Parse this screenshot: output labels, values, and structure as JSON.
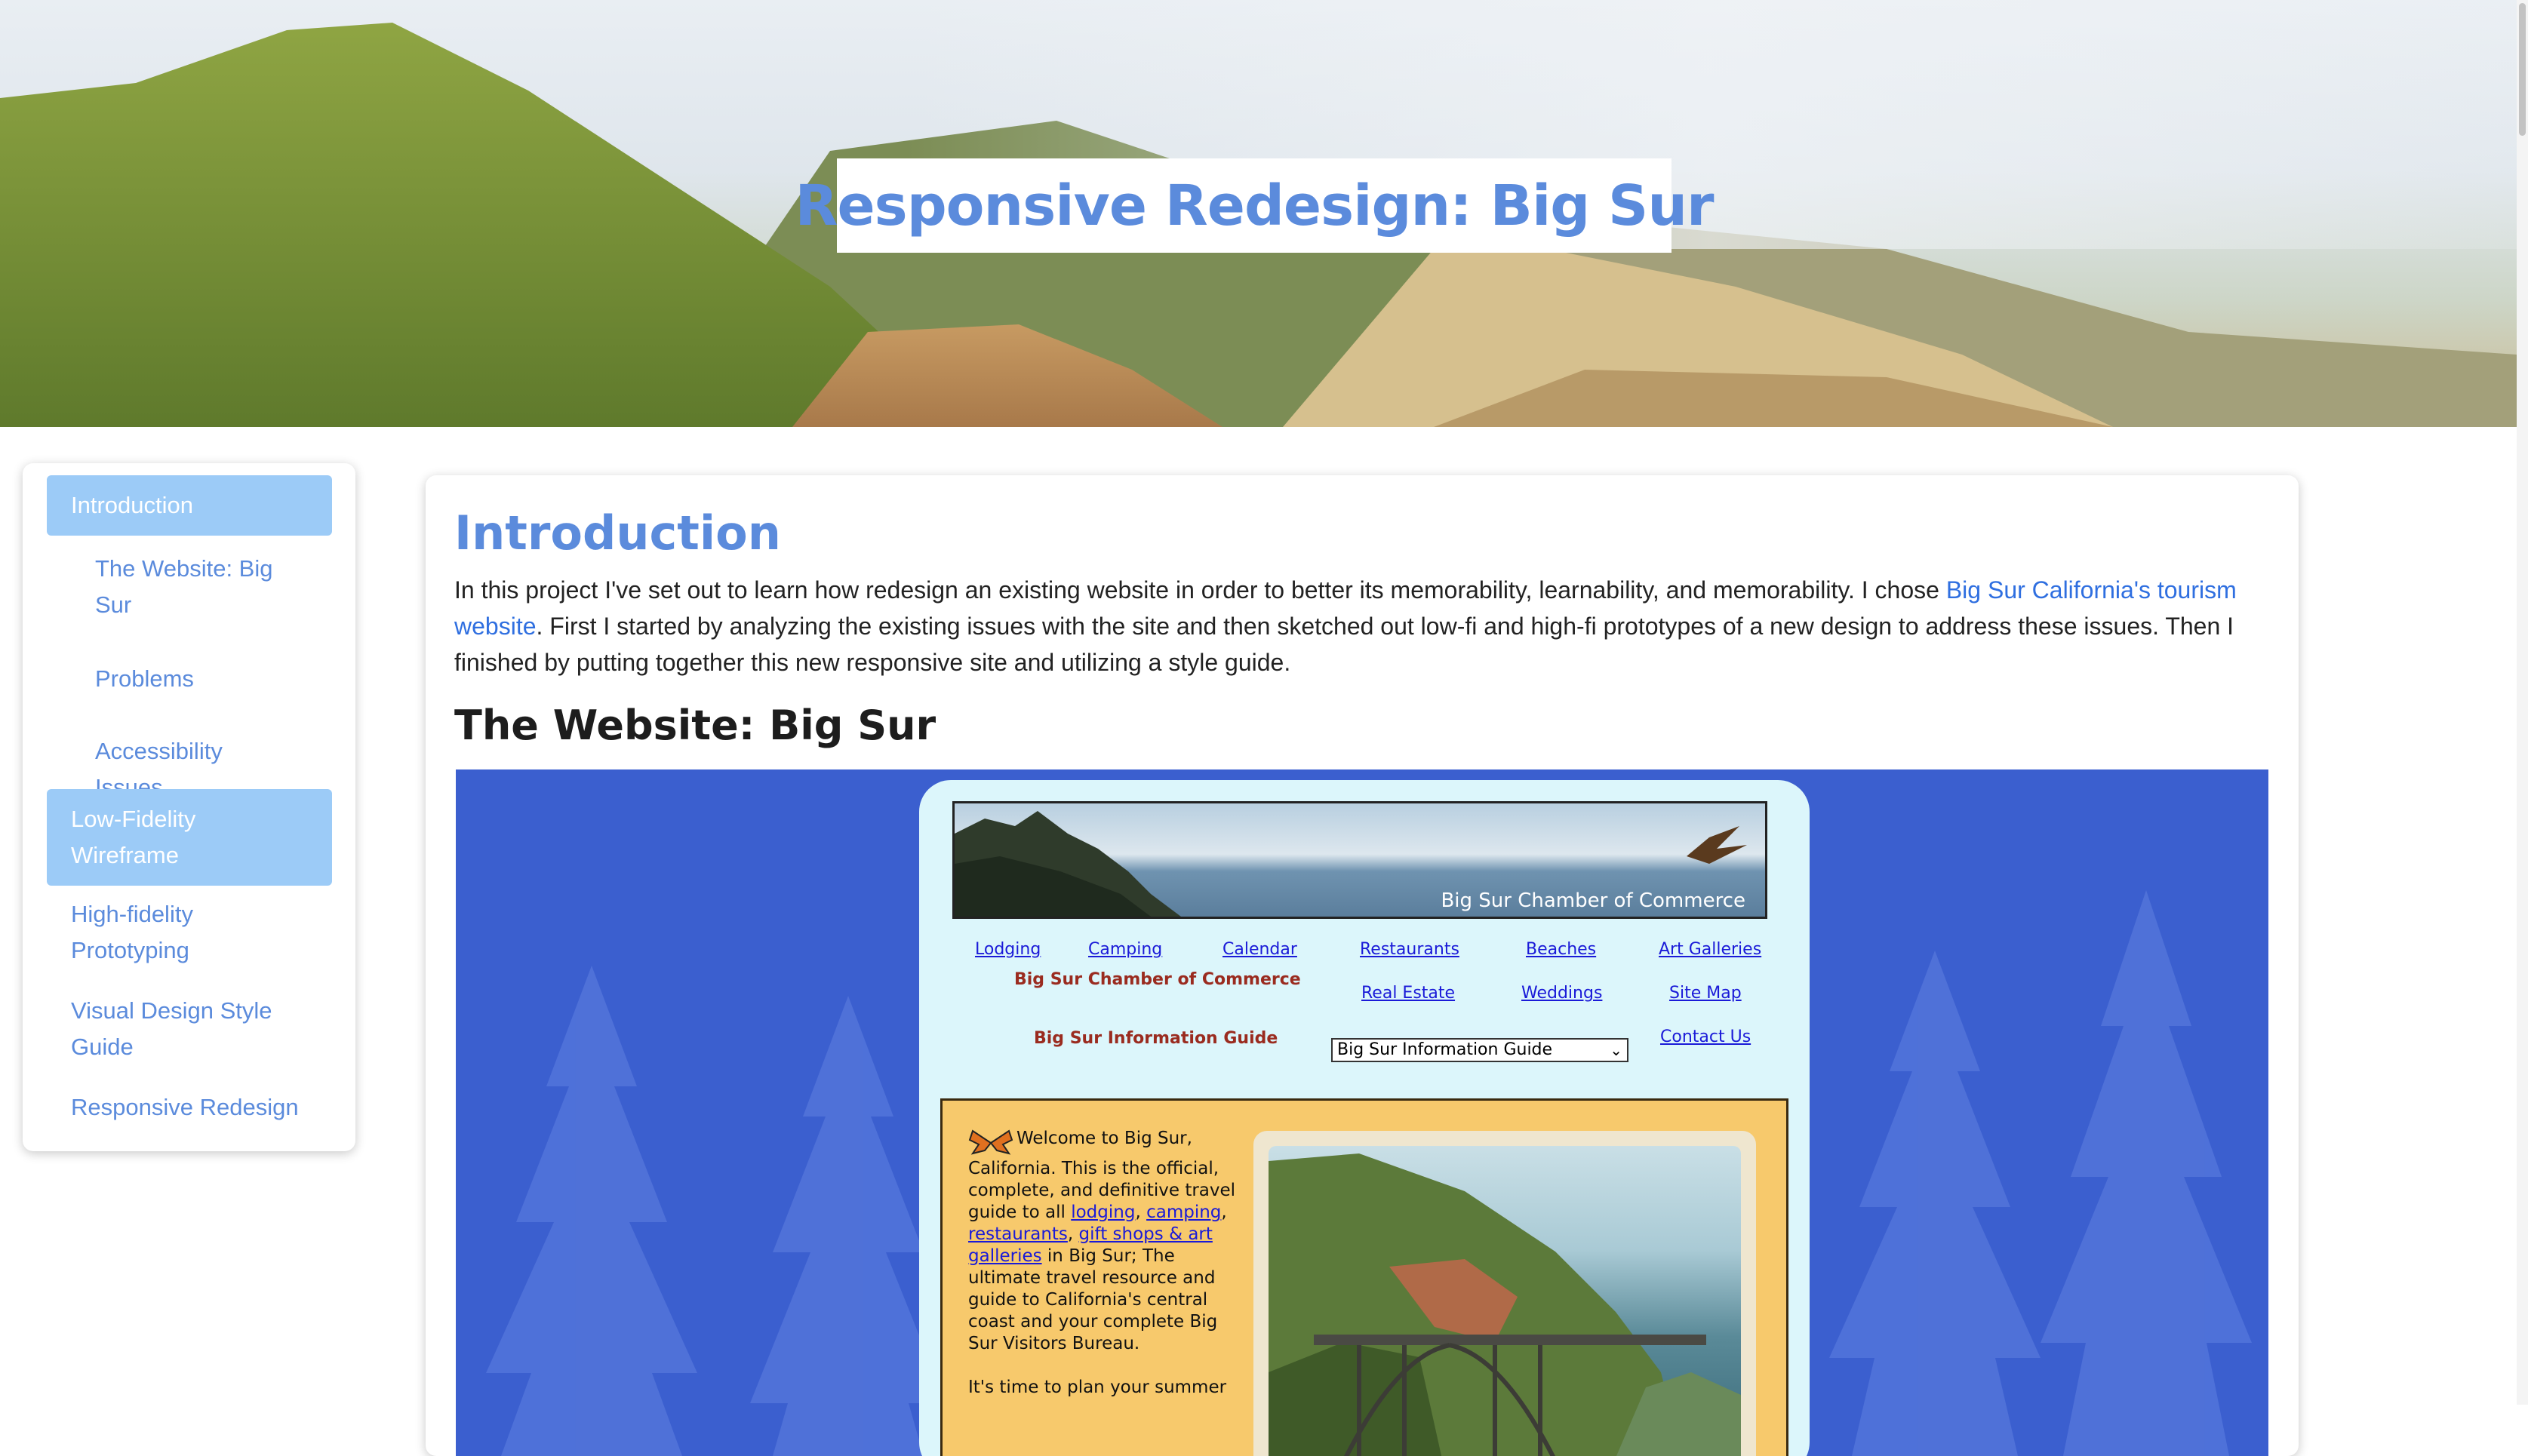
{
  "hero": {
    "title": "Responsive Redesign: Big Sur"
  },
  "sidebar": {
    "items": [
      {
        "label": "Introduction"
      },
      {
        "label": "The Website: Big Sur"
      },
      {
        "label": "Problems"
      },
      {
        "label": "Accessibility Issues"
      },
      {
        "label": "Low-Fidelity Wireframe"
      },
      {
        "label": "High-fidelity Prototyping"
      },
      {
        "label": "Visual Design Style Guide"
      },
      {
        "label": "Responsive Redesign"
      }
    ]
  },
  "main": {
    "intro_heading": "Introduction",
    "intro_before": "In this project I've set out to learn how redesign an existing website in order to better its memorability, learnability, and memorability. I chose ",
    "intro_link": "Big Sur California's tourism website",
    "intro_after": ". First I started by analyzing the existing issues with the site and then sketched out low-fi and high-fi prototypes of a new design to address these issues. Then I finished by putting together this new responsive site and utilizing a style guide.",
    "website_heading": "The Website: Big Sur"
  },
  "screenshot": {
    "banner_text": "Big Sur Chamber of Commerce",
    "nav_links": {
      "lodging": "Lodging",
      "camping": "Camping",
      "calendar": "Calendar",
      "restaurants": "Restaurants",
      "beaches": "Beaches",
      "art_galleries": "Art Galleries",
      "real_estate": "Real Estate",
      "weddings": "Weddings",
      "site_map": "Site Map",
      "contact_us": "Contact Us"
    },
    "chamber_label": "Big Sur Chamber of Commerce",
    "guide_label": "Big Sur Information Guide",
    "guide_select_value": "Big Sur Information Guide",
    "welcome": {
      "text1": "Welcome to Big Sur, California. This is the official, complete, and definitive travel guide to all ",
      "link_lodging": "lodging",
      "sep1": ", ",
      "link_camping": "camping",
      "sep2": ", ",
      "link_restaurants": "restaurants",
      "sep3": ", ",
      "link_gifts": "gift shops & art galleries",
      "text2": " in Big Sur; The ultimate travel resource and guide to California's central coast and your complete Big Sur Visitors Bureau.",
      "text3": "It's time to plan your summer"
    }
  },
  "colors": {
    "accent": "#5b8bdc",
    "nav_active_bg": "#9ccbf7",
    "link": "#2f6fe0",
    "screenshot_bg": "#3b5fcf"
  }
}
